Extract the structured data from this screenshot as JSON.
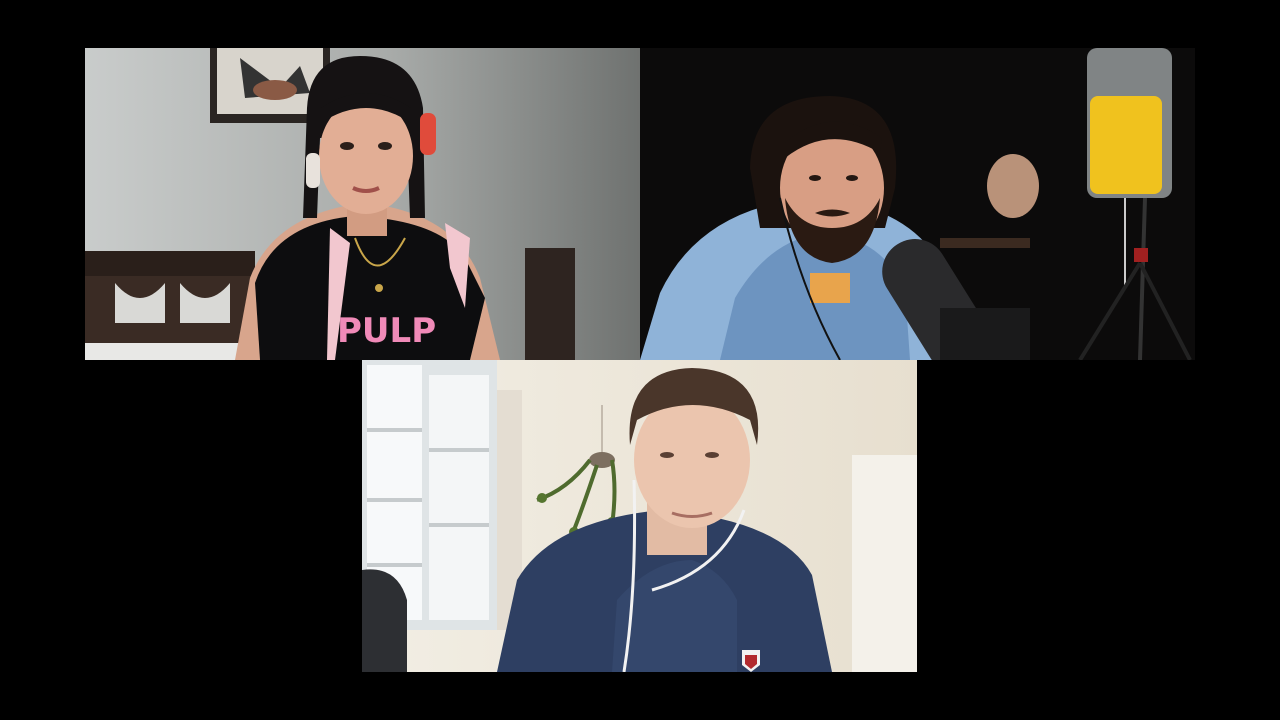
{
  "call": {
    "layout": "three-participant-gallery",
    "background_color": "#000000"
  },
  "participants": [
    {
      "position": "top-left",
      "icon": "participant-video",
      "shirt_text": "PULP"
    },
    {
      "position": "top-right",
      "icon": "participant-video"
    },
    {
      "position": "bottom-center",
      "icon": "participant-video"
    }
  ]
}
